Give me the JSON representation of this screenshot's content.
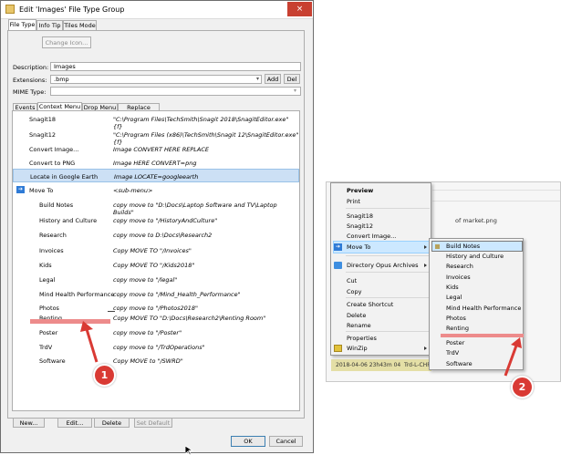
{
  "dialog": {
    "title": "Edit 'Images' File Type Group",
    "close_glyph": "×",
    "tabs": [
      "File Type",
      "Info Tip",
      "Tiles Mode"
    ],
    "change_icon_label": "Change Icon...",
    "description_label": "Description:",
    "description_value": "Images",
    "extensions_label": "Extensions:",
    "extensions_value": ".bmp",
    "add_label": "Add",
    "del_label": "Del",
    "mime_label": "MIME Type:",
    "mime_value": "",
    "inner_tabs": [
      "Events",
      "Context Menu",
      "Drop Menu",
      "Replace Menu"
    ],
    "rows": [
      {
        "name": "Snagit18",
        "command": "\"C:\\Program Files\\TechSmith\\Snagit 2018\\SnagitEditor.exe\" {f}"
      },
      {
        "name": "Snagit12",
        "command": "\"C:\\Program Files (x86)\\TechSmith\\Snagit 12\\SnagitEditor.exe\" {f}"
      },
      {
        "name": "Convert Image...",
        "command": "Image CONVERT HERE REPLACE"
      },
      {
        "name": "Convert to PNG",
        "command": "Image HERE CONVERT=png"
      },
      {
        "name": "Locate in Google Earth",
        "command": "Image LOCATE=googleearth"
      },
      {
        "name": "Move To",
        "command": "<sub-menu>"
      },
      {
        "name": "Build Notes",
        "command": "copy move to \"D:\\Docs\\Laptop Software and TV\\Laptop Builds\""
      },
      {
        "name": "History and Culture",
        "command": "copy move to \"/HistoryAndCulture\""
      },
      {
        "name": "Research",
        "command": "copy move to D:\\Docs\\Research2"
      },
      {
        "name": "Invoices",
        "command": "Copy MOVE TO \"/Invoices\""
      },
      {
        "name": "Kids",
        "command": "Copy MOVE TO \"/Kids2018\""
      },
      {
        "name": "Legal",
        "command": "copy move to \"/legal\""
      },
      {
        "name": "Mind Health Performance",
        "command": "copy move to \"/Mind_Health_Performance\""
      },
      {
        "name": "Photos",
        "command": "copy move to \"/Photos2018\""
      },
      {
        "name": "Renting",
        "command": "Copy MOVE TO \"D:\\Docs\\Research2\\Renting Room\""
      },
      {
        "name": "Poster",
        "command": "copy move to \"/Poster\""
      },
      {
        "name": "TrdV",
        "command": "copy move to \"/TrdOperations\""
      },
      {
        "name": "Software",
        "command": "Copy MOVE to \"/SWRD\""
      }
    ],
    "new_label": "New...",
    "edit_label": "Edit...",
    "delete_label": "Delete",
    "set_default_label": "Set Default",
    "ok_label": "OK",
    "cancel_label": "Cancel"
  },
  "background": {
    "file_text": "of market.png",
    "status_date": "2018-04-06 23h43m 04",
    "status_name": "Trd-L-CHF"
  },
  "context_menu": {
    "items": [
      "Preview",
      "Print",
      "Snagit18",
      "Snagit12",
      "Convert Image...",
      "Move To",
      "Directory Opus Archives",
      "Cut",
      "Copy",
      "Create Shortcut",
      "Delete",
      "Rename",
      "Properties",
      "WinZip"
    ]
  },
  "submenu": {
    "items": [
      "Build Notes",
      "History and Culture",
      "Research",
      "Invoices",
      "Kids",
      "Legal",
      "Mind Health Performance",
      "Photos",
      "Renting",
      "Poster",
      "TrdV",
      "Software"
    ]
  },
  "annotations": {
    "badge1": "1",
    "badge2": "2",
    "color": "#d93a34"
  }
}
